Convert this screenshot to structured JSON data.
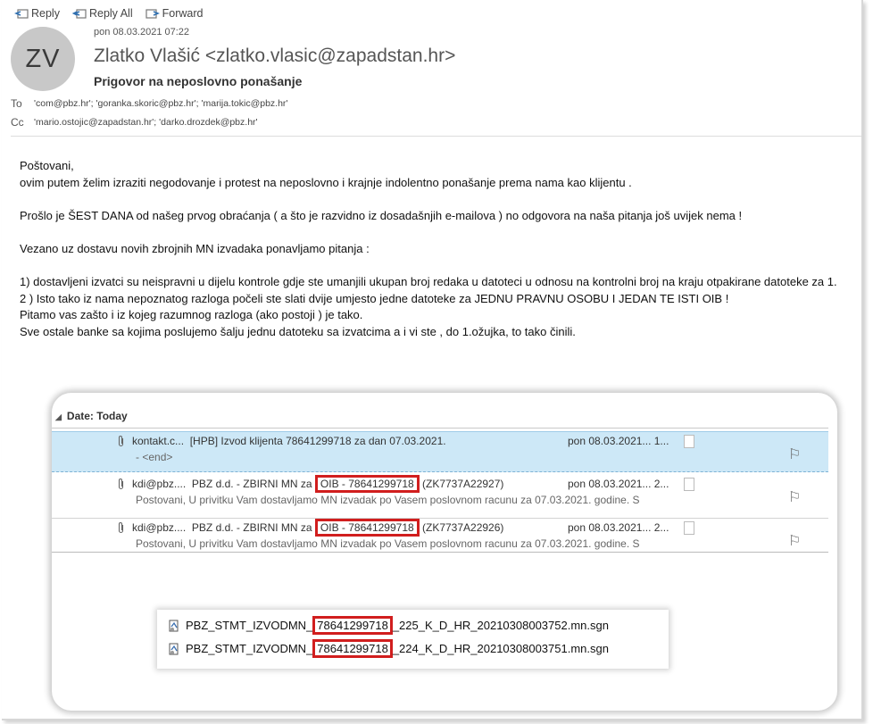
{
  "toolbar": {
    "reply": "Reply",
    "reply_all": "Reply All",
    "forward": "Forward"
  },
  "email": {
    "avatar_initials": "ZV",
    "date": "pon 08.03.2021 07:22",
    "sender": "Zlatko Vlašić <zlatko.vlasic@zapadstan.hr>",
    "subject": "Prigovor na neposlovno ponašanje",
    "to_label": "To",
    "to_value": "'com@pbz.hr'; 'goranka.skoric@pbz.hr'; 'marija.tokic@pbz.hr'",
    "cc_label": "Cc",
    "cc_value": "'mario.ostojic@zapadstan.hr'; 'darko.drozdek@pbz.hr'"
  },
  "body": {
    "p1": "Poštovani,",
    "p2": "ovim putem želim izraziti negodovanje i protest na neposlovno i krajnje indolentno ponašanje prema nama kao klijentu .",
    "p3": "Prošlo je ŠEST DANA od našeg prvog obraćanja ( a što je razvidno iz dosadašnjih e-mailova ) no odgovora na naša pitanja još uvijek nema !",
    "p4": "Vezano uz dostavu novih  zbrojnih  MN izvadaka  ponavljamo pitanja :",
    "p5": "1)  dostavljeni izvatci su  neispravni u dijelu kontrole gdje ste umanjili ukupan broj redaka u datoteci u odnosu na kontrolni broj na kraju otpakirane datoteke za 1.",
    "p6": "2 ) Isto tako iz nama nepoznatog razloga počeli ste slati dvije umjesto jedne datoteke za JEDNU PRAVNU OSOBU I JEDAN TE ISTI OIB !",
    "p7": "Pitamo vas zašto i iz kojeg razumnog razloga (ako postoji )  je tako.",
    "p8": "Sve ostale banke sa kojima poslujemo šalju jednu datoteku sa izvatcima a i vi ste , do 1.ožujka, to tako činili."
  },
  "screenshot": {
    "group_header": "Date: Today",
    "rows": [
      {
        "from": "kontakt.c...",
        "subject": "[HPB] Izvod klijenta 78641299718 za dan 07.03.2021.",
        "date": "pon 08.03.2021... 1...",
        "preview": "<end>"
      },
      {
        "from": "kdi@pbz....",
        "subject_pre": "PBZ d.d. - ZBIRNI MN za ",
        "subject_boxed": "OIB - 78641299718",
        "subject_post": " (ZK7737A22927)",
        "date": "pon 08.03.2021... 2...",
        "preview": "Postovani,  U privitku Vam dostavljamo MN izvadak po Vasem poslovnom racunu za 07.03.2021. godine.  S"
      },
      {
        "from": "kdi@pbz....",
        "subject_pre": "PBZ d.d. - ZBIRNI MN za ",
        "subject_boxed": "OIB - 78641299718",
        "subject_post": " (ZK7737A22926)",
        "date": "pon 08.03.2021... 2...",
        "preview": "Postovani,  U privitku Vam dostavljamo MN izvadak po Vasem poslovnom racunu za 07.03.2021. godine.  S"
      }
    ],
    "files": [
      {
        "pre": "PBZ_STMT_IZVODMN_",
        "boxed": "78641299718",
        "post": "_225_K_D_HR_20210308003752.mn.sgn"
      },
      {
        "pre": "PBZ_STMT_IZVODMN_",
        "boxed": "78641299718",
        "post": "_224_K_D_HR_20210308003751.mn.sgn"
      }
    ]
  }
}
